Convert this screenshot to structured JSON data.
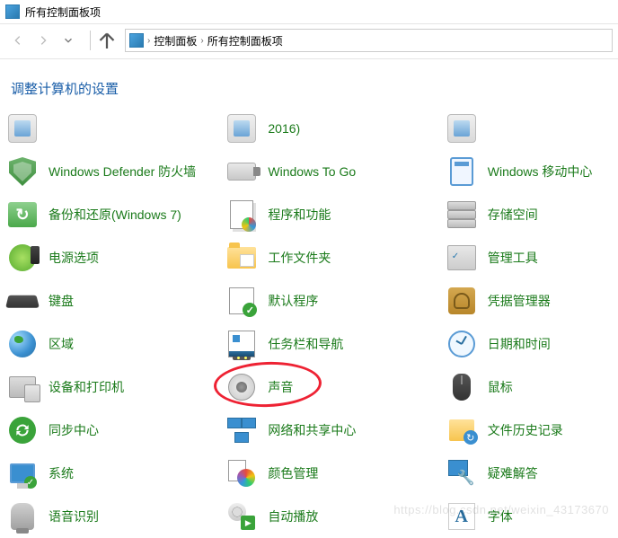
{
  "window": {
    "title": "所有控制面板项"
  },
  "breadcrumb": {
    "seg1": "控制面板",
    "seg2": "所有控制面板项"
  },
  "header": {
    "headline": "调整计算机的设置"
  },
  "items": {
    "truncated_date": "2016)",
    "windows_defender": "Windows Defender 防火墙",
    "windows_togo": "Windows To Go",
    "windows_mobile": "Windows 移动中心",
    "backup": "备份和还原(Windows 7)",
    "programs": "程序和功能",
    "storage": "存储空间",
    "power": "电源选项",
    "workfolders": "工作文件夹",
    "admintools": "管理工具",
    "keyboard": "键盘",
    "defaultapps": "默认程序",
    "credentials": "凭据管理器",
    "region": "区域",
    "taskbar": "任务栏和导航",
    "datetime": "日期和时间",
    "devices": "设备和打印机",
    "sound": "声音",
    "mouse": "鼠标",
    "sync": "同步中心",
    "network": "网络和共享中心",
    "filehistory": "文件历史记录",
    "system": "系统",
    "color": "颜色管理",
    "troubleshoot": "疑难解答",
    "speech": "语音识别",
    "autoplay": "自动播放",
    "fonts": "字体"
  },
  "watermark": "https://blog.csdn.net/weixin_43173670"
}
